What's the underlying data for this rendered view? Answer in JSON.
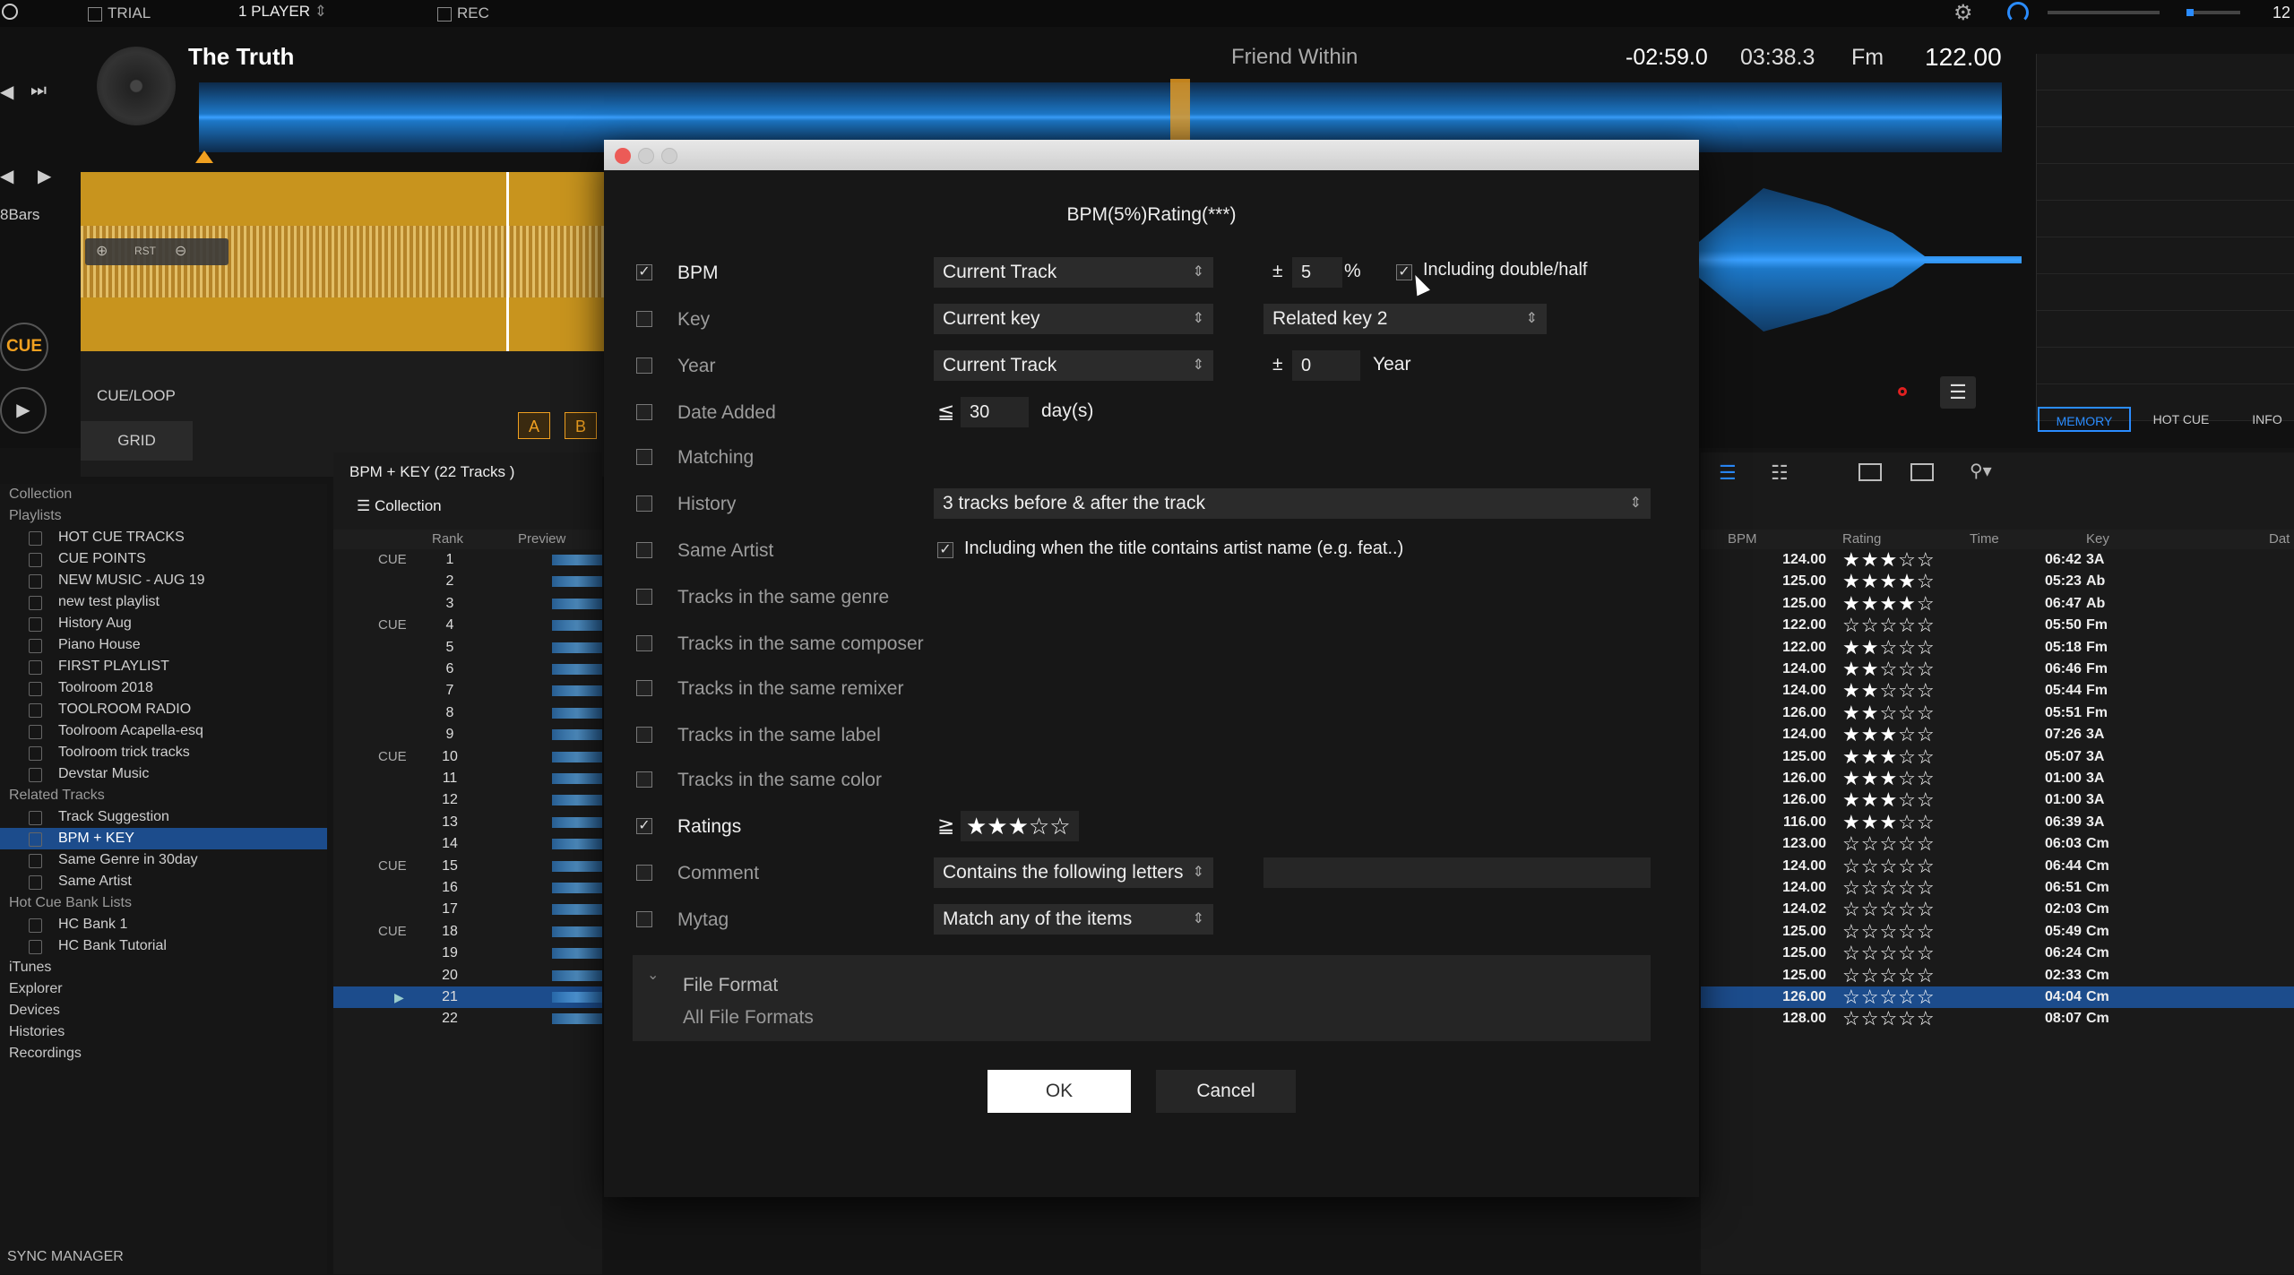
{
  "topbar": {
    "trial": "TRIAL",
    "player_mode": "1 PLAYER",
    "rec": "REC",
    "clock": "12"
  },
  "deck": {
    "title": "The Truth",
    "artist": "Friend Within",
    "remaining": "-02:59.0",
    "total": "03:38.3",
    "key": "Fm",
    "bpm": "122.00",
    "bars": "8Bars",
    "cue": "CUE",
    "cue_loop": "CUE/LOOP",
    "grid": "GRID",
    "rst": "RST",
    "loop_a": "A",
    "loop_b": "B",
    "tabs": [
      "MEMORY",
      "HOT CUE",
      "INFO"
    ]
  },
  "sidebar": {
    "collection": "Collection",
    "playlists_header": "Playlists",
    "playlists": [
      "HOT CUE TRACKS",
      "CUE POINTS",
      "NEW MUSIC - AUG 19",
      "new test playlist",
      "History Aug",
      "Piano House",
      "FIRST PLAYLIST",
      "Toolroom 2018",
      "TOOLROOM RADIO",
      "Toolroom Acapella-esq",
      "Toolroom trick tracks",
      "Devstar Music"
    ],
    "related_header": "Related Tracks",
    "related": [
      "Track Suggestion",
      "BPM + KEY",
      "Same Genre in 30day",
      "Same Artist"
    ],
    "hotcue_header": "Hot Cue Bank Lists",
    "hotcue": [
      "HC Bank 1",
      "HC Bank Tutorial"
    ],
    "bottom": [
      "iTunes",
      "Explorer",
      "Devices",
      "Histories",
      "Recordings"
    ],
    "sync": "SYNC MANAGER"
  },
  "tracklist": {
    "header": "BPM + KEY (22 Tracks )",
    "collection": "Collection",
    "col_rank": "Rank",
    "col_preview": "Preview",
    "cue_label": "CUE",
    "rows": [
      {
        "rank": "1",
        "cue": true
      },
      {
        "rank": "2",
        "cue": false
      },
      {
        "rank": "3",
        "cue": false
      },
      {
        "rank": "4",
        "cue": true
      },
      {
        "rank": "5",
        "cue": false
      },
      {
        "rank": "6",
        "cue": false
      },
      {
        "rank": "7",
        "cue": false
      },
      {
        "rank": "8",
        "cue": false
      },
      {
        "rank": "9",
        "cue": false
      },
      {
        "rank": "10",
        "cue": true
      },
      {
        "rank": "11",
        "cue": false
      },
      {
        "rank": "12",
        "cue": false
      },
      {
        "rank": "13",
        "cue": false
      },
      {
        "rank": "14",
        "cue": false
      },
      {
        "rank": "15",
        "cue": true
      },
      {
        "rank": "16",
        "cue": false
      },
      {
        "rank": "17",
        "cue": false
      },
      {
        "rank": "18",
        "cue": true
      },
      {
        "rank": "19",
        "cue": false
      },
      {
        "rank": "20",
        "cue": false
      },
      {
        "rank": "21",
        "cue": false,
        "selected": true
      },
      {
        "rank": "22",
        "cue": false
      }
    ]
  },
  "rightlist": {
    "cols": [
      "BPM",
      "Rating",
      "Time",
      "Key",
      "Dat"
    ],
    "rows": [
      {
        "bpm": "124.00",
        "stars": 3,
        "time": "06:42",
        "key": "3A"
      },
      {
        "bpm": "125.00",
        "stars": 4,
        "time": "05:23",
        "key": "Ab"
      },
      {
        "bpm": "125.00",
        "stars": 4,
        "time": "06:47",
        "key": "Ab"
      },
      {
        "bpm": "122.00",
        "stars": 0,
        "time": "05:50",
        "key": "Fm"
      },
      {
        "bpm": "122.00",
        "stars": 2,
        "time": "05:18",
        "key": "Fm"
      },
      {
        "bpm": "124.00",
        "stars": 2,
        "time": "06:46",
        "key": "Fm"
      },
      {
        "bpm": "124.00",
        "stars": 2,
        "time": "05:44",
        "key": "Fm"
      },
      {
        "bpm": "126.00",
        "stars": 2,
        "time": "05:51",
        "key": "Fm"
      },
      {
        "bpm": "124.00",
        "stars": 3,
        "time": "07:26",
        "key": "3A"
      },
      {
        "bpm": "125.00",
        "stars": 3,
        "time": "05:07",
        "key": "3A"
      },
      {
        "bpm": "126.00",
        "stars": 3,
        "time": "01:00",
        "key": "3A"
      },
      {
        "bpm": "126.00",
        "stars": 3,
        "time": "01:00",
        "key": "3A"
      },
      {
        "bpm": "116.00",
        "stars": 3,
        "time": "06:39",
        "key": "3A"
      },
      {
        "bpm": "123.00",
        "stars": 0,
        "time": "06:03",
        "key": "Cm"
      },
      {
        "bpm": "124.00",
        "stars": 0,
        "time": "06:44",
        "key": "Cm"
      },
      {
        "bpm": "124.00",
        "stars": 0,
        "time": "06:51",
        "key": "Cm"
      },
      {
        "bpm": "124.02",
        "stars": 0,
        "time": "02:03",
        "key": "Cm"
      },
      {
        "bpm": "125.00",
        "stars": 0,
        "time": "05:49",
        "key": "Cm"
      },
      {
        "bpm": "125.00",
        "stars": 0,
        "time": "06:24",
        "key": "Cm"
      },
      {
        "bpm": "125.00",
        "stars": 0,
        "time": "02:33",
        "key": "Cm"
      },
      {
        "bpm": "126.00",
        "stars": 0,
        "time": "04:04",
        "key": "Cm",
        "selected": true
      },
      {
        "bpm": "128.00",
        "stars": 0,
        "time": "08:07",
        "key": "Cm"
      }
    ]
  },
  "dialog": {
    "title": "BPM(5%)Rating(***)",
    "bpm": {
      "label": "BPM",
      "checked": true,
      "source": "Current Track",
      "pm": "±",
      "value": "5",
      "unit": "%",
      "double_half_label": "Including double/half",
      "double_half_checked": true
    },
    "key": {
      "label": "Key",
      "checked": false,
      "source": "Current key",
      "related": "Related key 2"
    },
    "year": {
      "label": "Year",
      "checked": false,
      "source": "Current Track",
      "pm": "±",
      "value": "0",
      "unit": "Year"
    },
    "date_added": {
      "label": "Date Added",
      "checked": false,
      "op": "≦",
      "value": "30",
      "unit": "day(s)"
    },
    "matching": {
      "label": "Matching",
      "checked": false
    },
    "history": {
      "label": "History",
      "checked": false,
      "value": "3 tracks before & after the track"
    },
    "same_artist": {
      "label": "Same Artist",
      "checked": false,
      "option_label": "Including when the title contains artist name (e.g. feat..)",
      "option_checked": true
    },
    "genre": {
      "label": "Tracks in the same genre",
      "checked": false
    },
    "composer": {
      "label": "Tracks in the same composer",
      "checked": false
    },
    "remixer": {
      "label": "Tracks in the same remixer",
      "checked": false
    },
    "label_row": {
      "label": "Tracks in the same label",
      "checked": false
    },
    "color": {
      "label": "Tracks in the same color",
      "checked": false
    },
    "ratings": {
      "label": "Ratings",
      "checked": true,
      "op": "≧",
      "stars": 3
    },
    "comment": {
      "label": "Comment",
      "checked": false,
      "value": "Contains the following letters"
    },
    "mytag": {
      "label": "Mytag",
      "checked": false,
      "value": "Match any of the items"
    },
    "file_format": {
      "label": "File Format",
      "value": "All File Formats"
    },
    "ok": "OK",
    "cancel": "Cancel"
  },
  "colors": {
    "accent": "#1c4c8c",
    "cue_orange": "#f0a020",
    "deck_gold": "#c8941e",
    "close_red": "#ec5b57"
  }
}
